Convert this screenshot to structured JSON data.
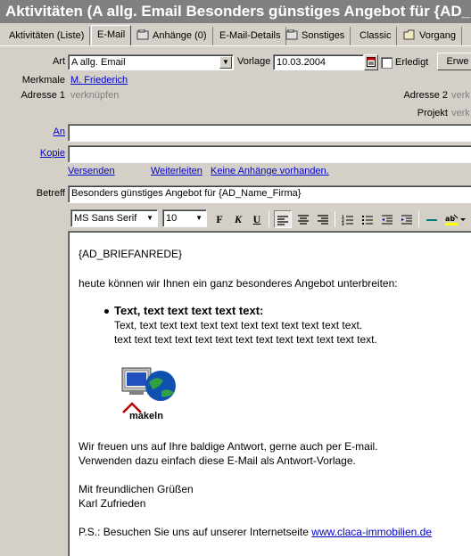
{
  "window": {
    "title": "Aktivitäten (A allg. Email Besonders günstiges Angebot für {AD_Name_Firma})"
  },
  "tabs": [
    {
      "label": "Aktivitäten (Liste)"
    },
    {
      "label": "E-Mail"
    },
    {
      "label": "Anhänge (0)"
    },
    {
      "label": "E-Mail-Details"
    },
    {
      "label": "Sonstiges"
    },
    {
      "label": "Classic"
    },
    {
      "label": "Vorgang"
    }
  ],
  "form": {
    "art_label": "Art",
    "art_value": "A allg. Email",
    "vorlage_label": "Vorlage",
    "vorlage_value": "10.03.2004",
    "erledigt_label": "Erledigt",
    "erw_button": "Erwe",
    "merkmale_label": "Merkmale",
    "merkmale_value": "M. Friederich",
    "adresse1_label": "Adresse 1",
    "adresse1_value": "verknüpfen",
    "adresse2_label": "Adresse 2",
    "adresse2_value": "verk",
    "projekt_label": "Projekt",
    "projekt_value": "verk",
    "an_label": "An",
    "an_value": "",
    "kopie_label": "Kopie",
    "kopie_value": "",
    "versenden": "Versenden",
    "weiterleiten": "Weiterleiten",
    "anhaenge": "Keine Anhänge vorhanden.",
    "betreff_label": "Betreff",
    "betreff_value": "Besonders günstiges Angebot für {AD_Name_Firma}"
  },
  "toolbar": {
    "font": "MS Sans Serif",
    "size": "10",
    "bold": "F",
    "italic": "K",
    "underline": "U"
  },
  "editor": {
    "salutation": "{AD_BRIEFANREDE}",
    "intro": "heute können wir Ihnen ein ganz besonderes Angebot unterbreiten:",
    "bullet_title": "Text, text text text text text:",
    "bullet_line1": "Text, text text text text text text text text text text text.",
    "bullet_line2": "text text text text text text text text text text text text text.",
    "logo_text": "makeln",
    "closing1": "Wir freuen uns auf Ihre baldige Antwort, gerne auch per E-mail.",
    "closing2": "Verwenden dazu einfach diese E-Mail als Antwort-Vorlage.",
    "greeting": "Mit freundlichen Grüßen",
    "name": "Karl Zufrieden",
    "ps_prefix": "P.S.: Besuchen Sie uns auf unserer Internetseite ",
    "ps_link": "www.claca-immobilien.de"
  }
}
